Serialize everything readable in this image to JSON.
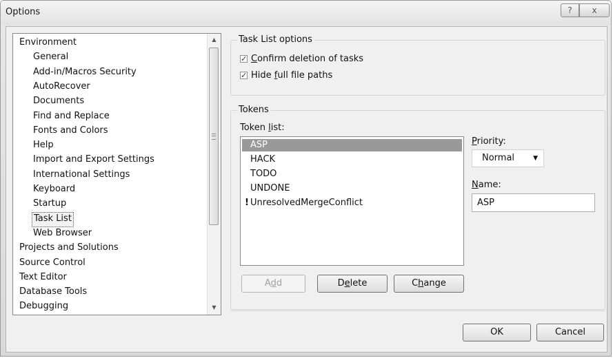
{
  "window": {
    "title": "Options",
    "help_glyph": "?",
    "close_glyph": "x"
  },
  "tree": {
    "items": [
      {
        "label": "Environment",
        "level": 0
      },
      {
        "label": "General",
        "level": 1
      },
      {
        "label": "Add-in/Macros Security",
        "level": 1
      },
      {
        "label": "AutoRecover",
        "level": 1
      },
      {
        "label": "Documents",
        "level": 1
      },
      {
        "label": "Find and Replace",
        "level": 1
      },
      {
        "label": "Fonts and Colors",
        "level": 1
      },
      {
        "label": "Help",
        "level": 1
      },
      {
        "label": "Import and Export Settings",
        "level": 1
      },
      {
        "label": "International Settings",
        "level": 1
      },
      {
        "label": "Keyboard",
        "level": 1
      },
      {
        "label": "Startup",
        "level": 1
      },
      {
        "label": "Task List",
        "level": 1,
        "selected": true
      },
      {
        "label": "Web Browser",
        "level": 1
      },
      {
        "label": "Projects and Solutions",
        "level": 0
      },
      {
        "label": "Source Control",
        "level": 0
      },
      {
        "label": "Text Editor",
        "level": 0
      },
      {
        "label": "Database Tools",
        "level": 0
      },
      {
        "label": "Debugging",
        "level": 0
      }
    ],
    "scroll_up_glyph": "▲",
    "scroll_down_glyph": "▼"
  },
  "task_list_options": {
    "group_label": "Task List options",
    "confirm_deletion": {
      "underline": "C",
      "rest": "onfirm deletion of tasks",
      "checked": true
    },
    "hide_paths": {
      "before": "Hide ",
      "underline": "f",
      "rest": "ull file paths",
      "checked": true
    },
    "check_glyph": "✓"
  },
  "tokens": {
    "group_label": "Tokens",
    "token_list_label": {
      "before": "Token ",
      "underline": "l",
      "rest": "ist:"
    },
    "items": [
      {
        "label": "ASP",
        "selected": true,
        "warning": false
      },
      {
        "label": "HACK",
        "selected": false,
        "warning": false
      },
      {
        "label": "TODO",
        "selected": false,
        "warning": false
      },
      {
        "label": "UNDONE",
        "selected": false,
        "warning": false
      },
      {
        "label": "UnresolvedMergeConflict",
        "selected": false,
        "warning": true
      }
    ],
    "warning_glyph": "!",
    "priority_label": {
      "underline": "P",
      "rest": "riority:"
    },
    "priority_value": "Normal",
    "dropdown_glyph": "▼",
    "name_label": {
      "underline": "N",
      "rest": "ame:"
    },
    "name_value": "ASP",
    "add_button": {
      "before": "A",
      "underline": "d",
      "rest": "d",
      "enabled": false
    },
    "delete_button": {
      "before": "D",
      "underline": "e",
      "rest": "lete"
    },
    "change_button": {
      "before": "C",
      "underline": "h",
      "rest": "ange"
    }
  },
  "footer": {
    "ok_label": "OK",
    "cancel_label": "Cancel"
  }
}
